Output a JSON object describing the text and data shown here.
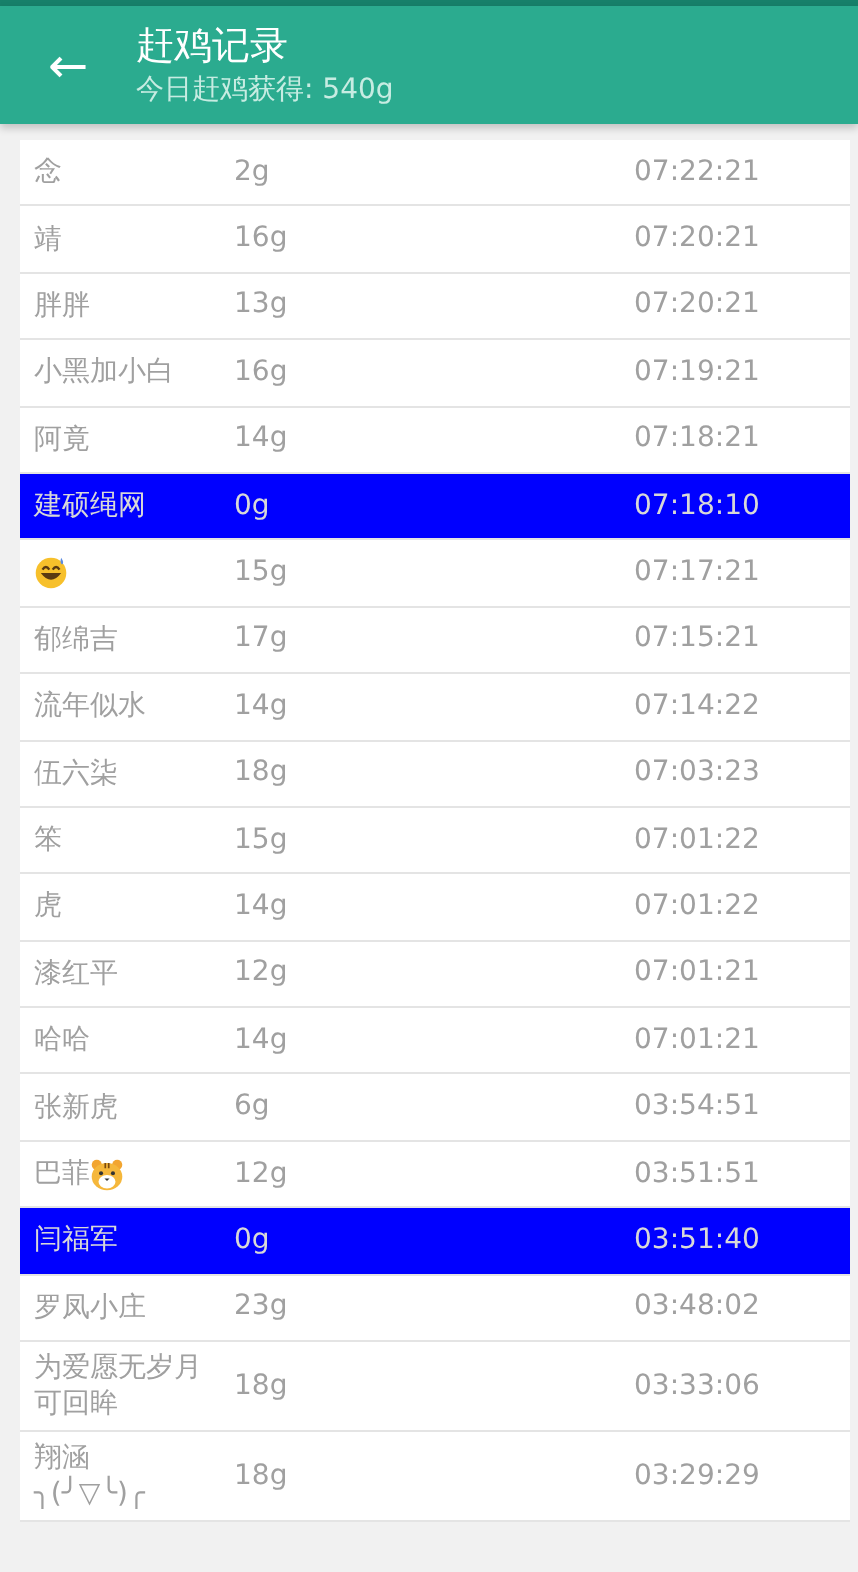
{
  "header": {
    "back": "←",
    "title": "赶鸡记录",
    "subtitle": "今日赶鸡获得: 540g"
  },
  "rows": [
    {
      "name": "念",
      "weight": "2g",
      "time": "07:22:21",
      "selected": false
    },
    {
      "name": "靖",
      "weight": "16g",
      "time": "07:20:21",
      "selected": false
    },
    {
      "name": "胖胖",
      "weight": "13g",
      "time": "07:20:21",
      "selected": false
    },
    {
      "name": "小黑加小白",
      "weight": "16g",
      "time": "07:19:21",
      "selected": false
    },
    {
      "name": "阿竟",
      "weight": "14g",
      "time": "07:18:21",
      "selected": false
    },
    {
      "name": "建硕绳网",
      "weight": "0g",
      "time": "07:18:10",
      "selected": true
    },
    {
      "kind": "face",
      "weight": "15g",
      "time": "07:17:21",
      "selected": false
    },
    {
      "name": "郁绵吉",
      "weight": "17g",
      "time": "07:15:21",
      "selected": false
    },
    {
      "name": "流年似水",
      "weight": "14g",
      "time": "07:14:22",
      "selected": false
    },
    {
      "name": "伍六柒",
      "weight": "18g",
      "time": "07:03:23",
      "selected": false
    },
    {
      "name": "笨",
      "weight": "15g",
      "time": "07:01:22",
      "selected": false
    },
    {
      "name": "虎",
      "weight": "14g",
      "time": "07:01:22",
      "selected": false
    },
    {
      "name": "漆红平",
      "weight": "12g",
      "time": "07:01:21",
      "selected": false
    },
    {
      "name": "哈哈",
      "weight": "14g",
      "time": "07:01:21",
      "selected": false
    },
    {
      "name": "张新虎",
      "weight": "6g",
      "time": "03:54:51",
      "selected": false
    },
    {
      "name": "巴菲",
      "kind": "tiger",
      "weight": "12g",
      "time": "03:51:51",
      "selected": false
    },
    {
      "name": "闫福军",
      "weight": "0g",
      "time": "03:51:40",
      "selected": true
    },
    {
      "name": "罗凤小庄",
      "weight": "23g",
      "time": "03:48:02",
      "selected": false
    },
    {
      "name": "为爱愿无岁月可回眸",
      "weight": "18g",
      "time": "03:33:06",
      "selected": false
    },
    {
      "name": "翔涵 ╮(╯▽╰)╭",
      "weight": "18g",
      "time": "03:29:29",
      "selected": false
    }
  ]
}
